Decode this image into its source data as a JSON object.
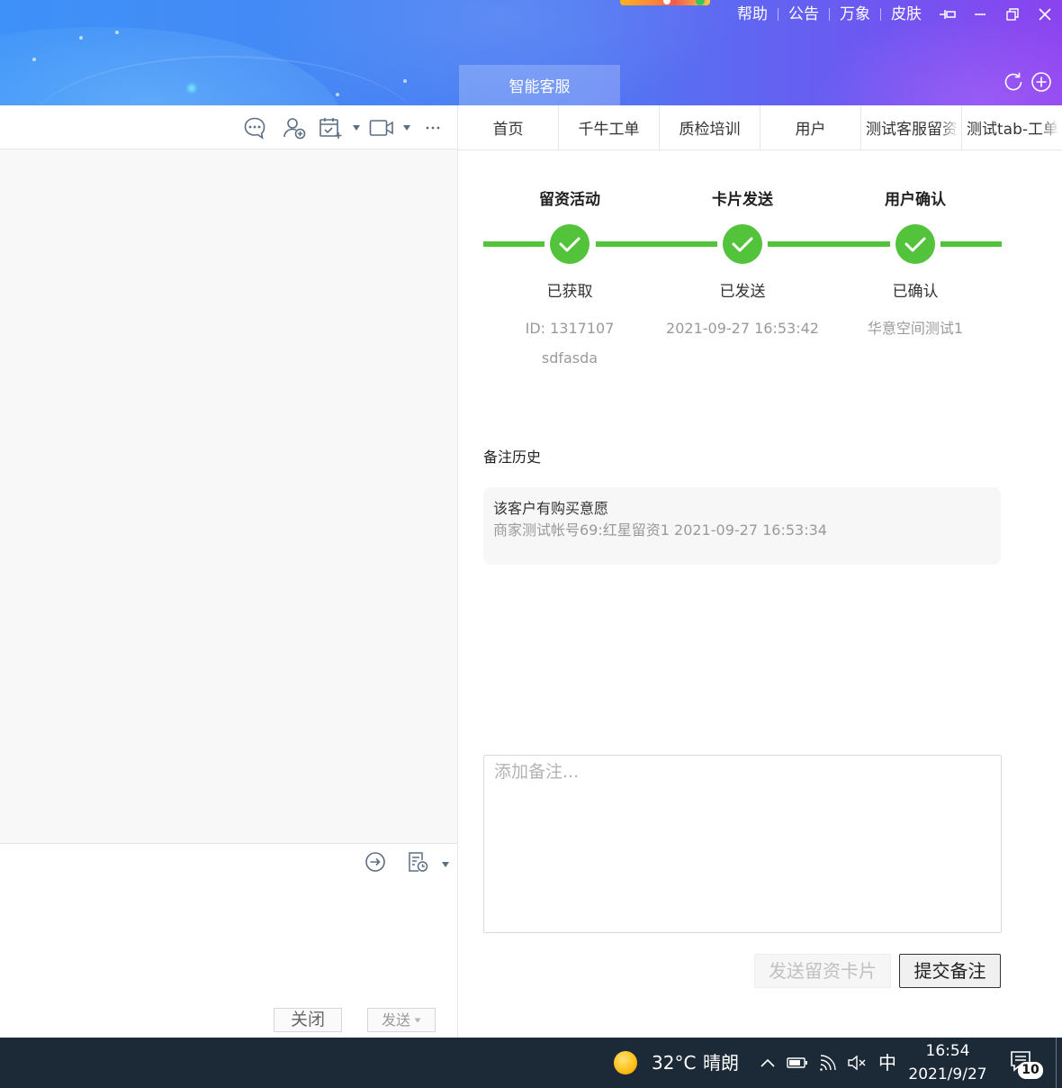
{
  "header": {
    "top_links": [
      "帮助",
      "公告",
      "万象",
      "皮肤"
    ],
    "window_controls": [
      "pin-icon",
      "minimize-icon",
      "restore-icon",
      "close-icon"
    ],
    "app_tab": "智能客服",
    "actions": [
      "refresh-icon",
      "add-circle-icon"
    ]
  },
  "chat": {
    "toolbar_icons": [
      "chat-dots-icon",
      "user-add-icon",
      "calendar-check-icon",
      "video-icon",
      "more-icon"
    ],
    "input_toolbar_icons": [
      "transfer-icon",
      "history-record-icon"
    ],
    "close_label": "关闭",
    "send_label": "发送"
  },
  "workspace": {
    "tabs": [
      "首页",
      "千牛工单",
      "质检培训",
      "用户",
      "测试客服留资",
      "测试tab-工单"
    ],
    "steps": [
      {
        "title": "留资活动",
        "status": "已获取",
        "details": [
          "ID: 1317107",
          "sdfasda"
        ],
        "completed": true
      },
      {
        "title": "卡片发送",
        "status": "已发送",
        "details": [
          "2021-09-27 16:53:42"
        ],
        "completed": true
      },
      {
        "title": "用户确认",
        "status": "已确认",
        "details": [
          "华意空间测试1"
        ],
        "completed": true
      }
    ],
    "history_title": "备注历史",
    "notes": [
      {
        "content": "该客户有购买意愿",
        "meta": "商家测试帐号69:红星留资1 2021-09-27 16:53:34"
      }
    ],
    "note_placeholder": "添加备注...",
    "send_card_label": "发送留资卡片",
    "submit_label": "提交备注"
  },
  "taskbar": {
    "temperature": "32°C",
    "weather": "晴朗",
    "ime": "中",
    "time": "16:54",
    "date": "2021/9/27",
    "notification_count": "10",
    "tray_icons": [
      "chevron-up-icon",
      "battery-icon",
      "wifi-icon",
      "speaker-muted-icon",
      "notification-icon"
    ]
  },
  "colors": {
    "header_start": "#3d91f8",
    "header_end": "#8b43ef",
    "step_complete": "#52c33a",
    "toolbar_icon": "#5c6e82",
    "taskbar": "#1c2a38"
  }
}
